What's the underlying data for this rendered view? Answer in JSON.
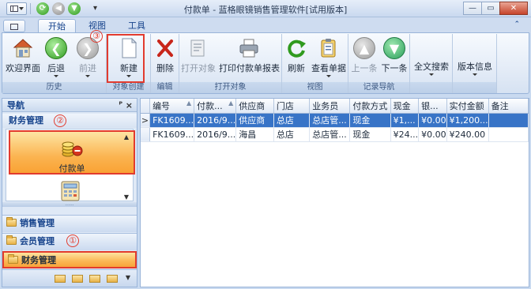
{
  "window": {
    "title": "付款单 - 蓝格眼镜销售管理软件[试用版本]",
    "controls": {
      "minimize": "—",
      "restore": "▭",
      "close": "✕"
    }
  },
  "quick_access": {
    "dropdown_glyph": "▾"
  },
  "ribbon": {
    "tabs": [
      {
        "label": "开始",
        "active": true
      },
      {
        "label": "视图",
        "active": false
      },
      {
        "label": "工具",
        "active": false
      }
    ],
    "groups": [
      {
        "label": "历史",
        "buttons": [
          "欢迎界面",
          "后退",
          "前进"
        ]
      },
      {
        "label": "对象创建",
        "buttons": [
          "新建"
        ]
      },
      {
        "label": "编辑",
        "buttons": [
          "删除"
        ]
      },
      {
        "label": "打开对象",
        "buttons": [
          "打开对象",
          "打印付款单报表"
        ]
      },
      {
        "label": "视图",
        "buttons": [
          "刷新",
          "查看单据"
        ]
      },
      {
        "label": "记录导航",
        "buttons": [
          "上一条",
          "下一条"
        ]
      },
      {
        "label": "",
        "buttons": [
          "全文搜索"
        ]
      },
      {
        "label": "",
        "buttons": [
          "版本信息"
        ]
      }
    ],
    "annotation": "③"
  },
  "navigation": {
    "header": "导航",
    "pin_glyph": "ᴾ",
    "close_glyph": "×",
    "section_title": "财务管理",
    "section_annotation": "②",
    "active_item": "付款单",
    "scroll_up": "▲",
    "scroll_down": "▼",
    "grip": "......",
    "groups": [
      {
        "label": "销售管理",
        "active": false
      },
      {
        "label": "会员管理",
        "active": false,
        "annotation": "①"
      },
      {
        "label": "财务管理",
        "active": true
      }
    ],
    "footer_more": "▼"
  },
  "grid": {
    "columns": [
      "编号",
      "付款...",
      "供应商",
      "门店",
      "业务员",
      "付款方式",
      "现金",
      "银...",
      "实付金额",
      "备注"
    ],
    "sort_mark": "▲",
    "row_indicator": ">",
    "rows": [
      {
        "selected": true,
        "cells": [
          "FK1609...",
          "2016/9...",
          "供应商",
          "总店",
          "总店管...",
          "现金",
          "¥1,...",
          "¥0.00",
          "¥1,200...",
          ""
        ]
      },
      {
        "selected": false,
        "cells": [
          "FK1609...",
          "2016/9...",
          "海昌",
          "总店",
          "总店管...",
          "现金",
          "¥24...",
          "¥0.00",
          "¥240.00",
          ""
        ]
      }
    ]
  },
  "colors": {
    "accent_blue": "#3874c7",
    "highlight_orange": "#fbb451",
    "annotation_red": "#e23b2e"
  }
}
